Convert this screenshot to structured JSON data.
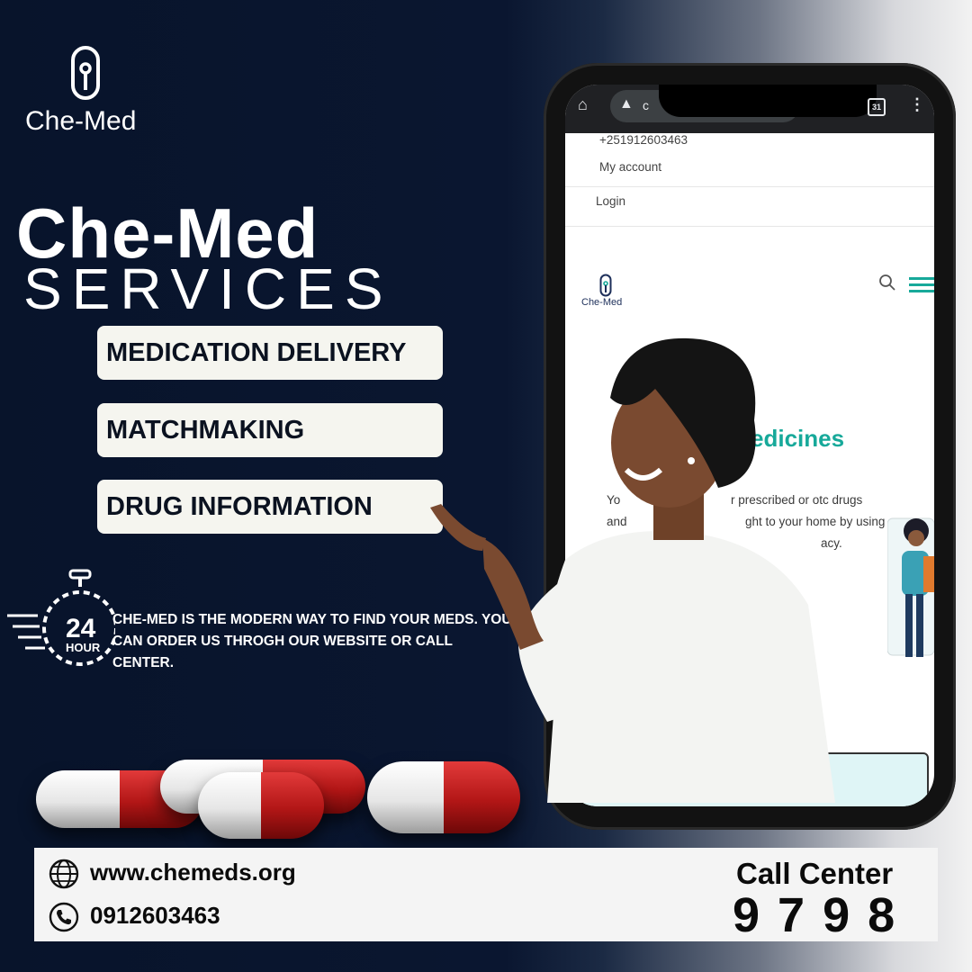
{
  "brand": {
    "name": "Che-Med"
  },
  "heading": {
    "title": "Che-Med",
    "subtitle": "SERVICES"
  },
  "services": [
    "MEDICATION DELIVERY",
    "MATCHMAKING",
    "DRUG INFORMATION"
  ],
  "badge": {
    "number": "24",
    "unit": "HOUR"
  },
  "description": "CHE-MED IS THE MODERN WAY TO FIND YOUR MEDS. YOU CAN ORDER US THROGH OUR WEBSITE OR CALL CENTER.",
  "phone_screen": {
    "browser": {
      "url_partial": "c",
      "tab_count": "31"
    },
    "menu": {
      "phone": "+251912603463",
      "account": "My account",
      "login": "Login"
    },
    "site_logo": "Che-Med",
    "hero_title": "edicines",
    "hero_lines": [
      "Yo",
      "r prescribed or otc drugs",
      "and",
      "ght to your home by using",
      "acy."
    ]
  },
  "contact": {
    "website": "www.chemeds.org",
    "phone": "0912603463",
    "call_center_label": "Call Center",
    "call_center_number": "9798"
  },
  "colors": {
    "navy": "#08142b",
    "teal": "#17a99a",
    "pill_red": "#c21e1e",
    "card_bg": "#f5f5ef"
  }
}
